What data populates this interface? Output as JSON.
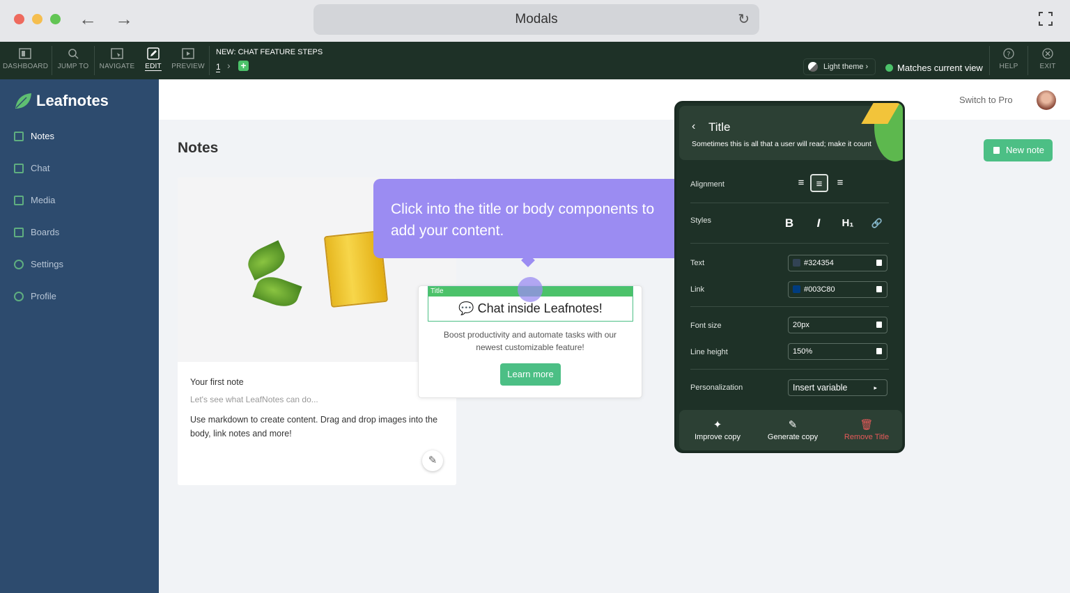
{
  "browser": {
    "url_title": "Modals",
    "reload_icon": "↻",
    "back_icon": "←",
    "forward_icon": "→"
  },
  "editor_bar": {
    "buttons": [
      {
        "label": "DASHBOARD"
      },
      {
        "label": "JUMP TO"
      },
      {
        "label": "NAVIGATE"
      },
      {
        "label": "EDIT"
      },
      {
        "label": "PREVIEW"
      },
      {
        "label": "HELP"
      },
      {
        "label": "EXIT"
      }
    ],
    "flow_title": "NEW: CHAT FEATURE STEPS",
    "step_number": "1",
    "step_chevron": "›",
    "add_step_icon": "+",
    "theme_label": "Light theme ›",
    "match_label": "Matches current view"
  },
  "sidebar": {
    "brand": "Leafnotes",
    "items": [
      {
        "label": "Notes"
      },
      {
        "label": "Chat"
      },
      {
        "label": "Media"
      },
      {
        "label": "Boards"
      },
      {
        "label": "Settings"
      },
      {
        "label": "Profile"
      }
    ]
  },
  "header": {
    "switch_pro": "Switch to Pro"
  },
  "main": {
    "page_title": "Notes",
    "new_note_label": "New note",
    "note_card": {
      "title": "Your first note",
      "subtitle": "Let's see what LeafNotes can do...",
      "body": "Use markdown to create content. Drag and drop images into the body, link notes and more!",
      "edit_icon": "✎"
    }
  },
  "modal": {
    "title_tag": "Title",
    "title": "💬 Chat inside Leafnotes!",
    "body": "Boost productivity and automate tasks with our newest customizable feature!",
    "button": "Learn more"
  },
  "tooltip": {
    "text": "Click into the title or body components to add your content."
  },
  "panel": {
    "back_icon": "‹",
    "title": "Title",
    "description": "Sometimes this is all that a user will read; make it count",
    "alignment_label": "Alignment",
    "align_icons": [
      "≡",
      "≡",
      "≡"
    ],
    "styles_label": "Styles",
    "style_icons": [
      "B",
      "I",
      "H₁",
      "🔗"
    ],
    "text_label": "Text",
    "text_color": "#324354",
    "link_label": "Link",
    "link_color": "#003C80",
    "font_size_label": "Font size",
    "font_size": "20px",
    "line_height_label": "Line height",
    "line_height": "150%",
    "personalization_label": "Personalization",
    "insert_variable": "Insert variable",
    "insert_arrow": "▸",
    "footer": {
      "improve": "Improve copy",
      "improve_icon": "✦",
      "generate": "Generate copy",
      "generate_icon": "✎",
      "remove": "Remove Title",
      "remove_icon": "🗑"
    }
  },
  "colors": {
    "accent": "#4cbf85",
    "sidebar": "#2d4b6e",
    "editor_bar": "#1e3127",
    "tooltip": "#9b8cf2"
  }
}
